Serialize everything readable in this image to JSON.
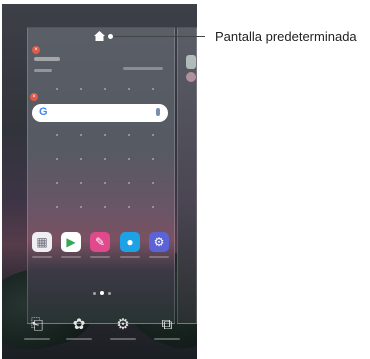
{
  "callout": {
    "label": "Pantalla predeterminada"
  },
  "search": {
    "logo": "G"
  },
  "apps": [
    {
      "name": "apps-folder-icon",
      "color": "#f0eef2"
    },
    {
      "name": "play-store-icon",
      "color": "#ffffff"
    },
    {
      "name": "pen-icon",
      "color": "#e04a8d"
    },
    {
      "name": "messages-icon",
      "color": "#1ea2e6"
    },
    {
      "name": "settings-icon",
      "color": "#5b63d6"
    }
  ],
  "bottom_bar": [
    {
      "name": "widgets-icon",
      "glyph": "⎗"
    },
    {
      "name": "wallpaper-theme-icon",
      "glyph": "✿"
    },
    {
      "name": "home-settings-icon",
      "glyph": "⚙"
    },
    {
      "name": "edit-pages-icon",
      "glyph": "⧉"
    }
  ]
}
